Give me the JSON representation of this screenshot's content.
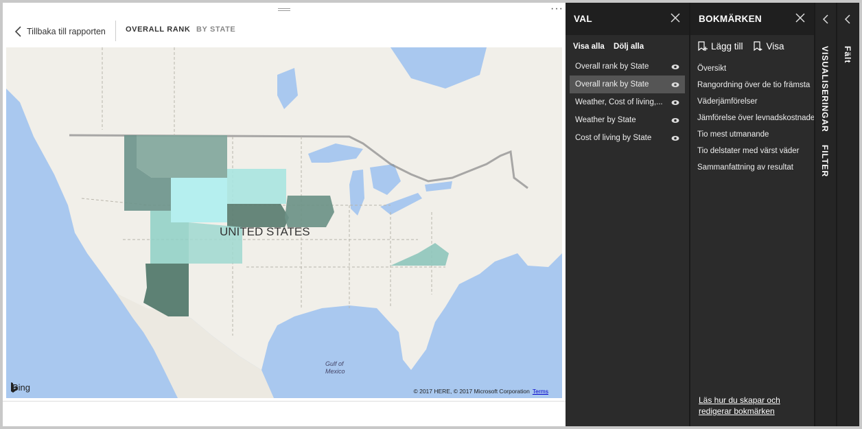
{
  "nav": {
    "back_label": "Tillbaka till rapporten",
    "tabs": [
      {
        "label": "OVERALL RANK",
        "active": true
      },
      {
        "label": "BY STATE",
        "active": false
      }
    ],
    "more": "···"
  },
  "map": {
    "country_label": "UNITED STATES",
    "gulf_label_1": "Gulf of",
    "gulf_label_2": "Mexico",
    "bing_label": "Bing",
    "copyright": "© 2017 HERE, © 2017 Microsoft Corporation",
    "terms": "Terms"
  },
  "val": {
    "title": "VAL",
    "show_all": "Visa alla",
    "hide_all": "Dölj alla",
    "items": [
      {
        "label": "Overall rank by State",
        "selected": false
      },
      {
        "label": "Overall rank by State",
        "selected": true
      },
      {
        "label": "Weather, Cost of living,...",
        "selected": false
      },
      {
        "label": "Weather by State",
        "selected": false
      },
      {
        "label": "Cost of living by State",
        "selected": false
      }
    ]
  },
  "bookmarks": {
    "title": "BOKMÄRKEN",
    "add_label": "Lägg till",
    "view_label": "Visa",
    "items": [
      "Översikt",
      "Rangordning över de tio främsta",
      "Väderjämförelser",
      "Jämförelse över levnadskostnader",
      "Tio mest utmanande",
      "Tio delstater med värst väder",
      "Sammanfattning av resultat"
    ],
    "help_link": "Läs hur du skapar och redigerar bokmärken"
  },
  "side_tabs": {
    "visualizations": "VISUALISERINGAR",
    "filter": "FILTER",
    "fields": "Fält"
  },
  "colors": {
    "panel_bg": "#2b2b2b",
    "panel_header": "#1f1f1f",
    "selected_row": "#555555",
    "water": "#a9c8ef",
    "land": "#f1efe9"
  }
}
